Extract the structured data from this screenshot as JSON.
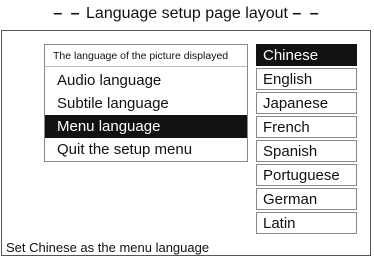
{
  "header": {
    "title": "Language setup page layout",
    "left_dashes": "– –",
    "right_dashes": "– –"
  },
  "menu": {
    "items": [
      {
        "label": "The language of the picture displayed"
      },
      {
        "label": "Audio language"
      },
      {
        "label": "Subtile language"
      },
      {
        "label": "Menu language",
        "selected": true
      },
      {
        "label": "Quit the setup menu"
      }
    ]
  },
  "languages": {
    "options": [
      "Chinese",
      "English",
      "Japanese",
      "French",
      "Spanish",
      "Portuguese",
      "German",
      "Latin"
    ],
    "selected": "Chinese"
  },
  "status": {
    "text": "Set Chinese as the menu language"
  }
}
